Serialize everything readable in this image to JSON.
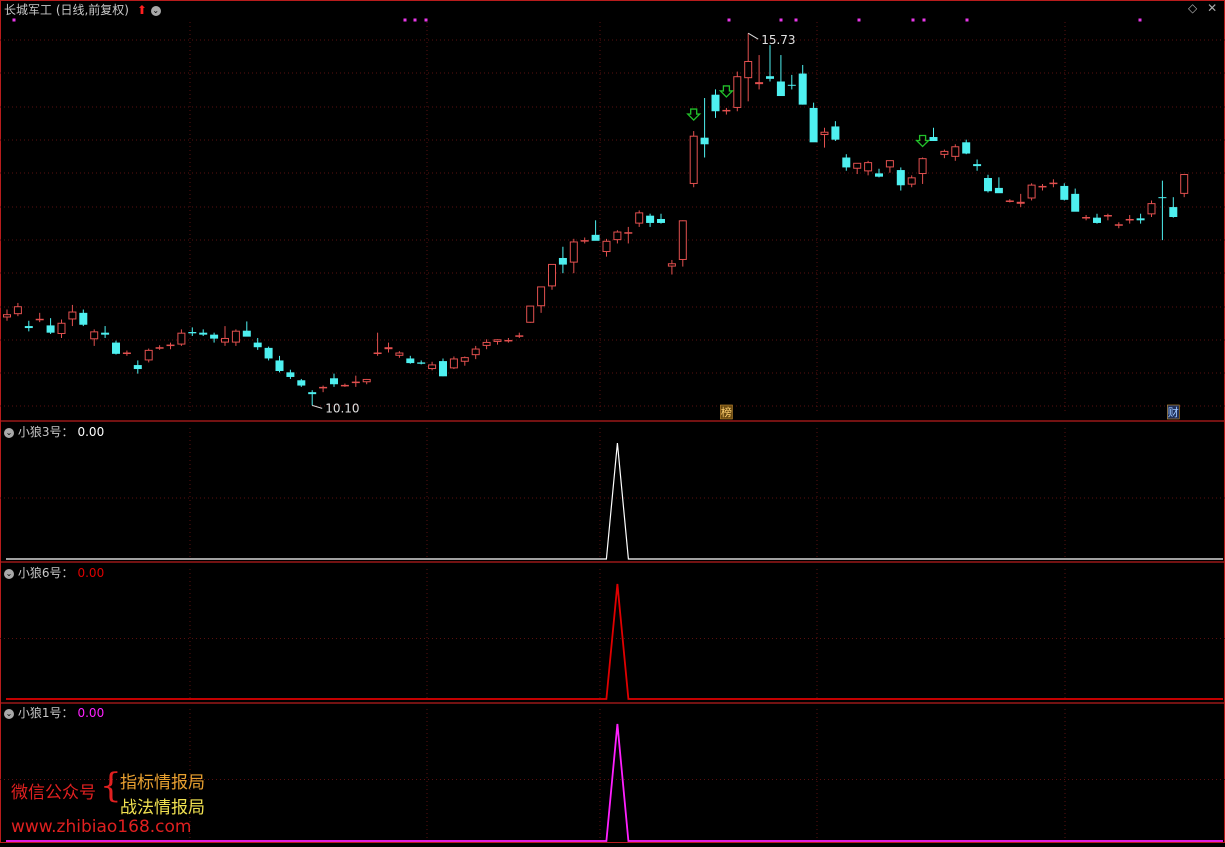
{
  "header": {
    "title": "长城军工 (日线,前复权)",
    "arrow_color": "#ff2020",
    "icons": [
      "red-up-arrow-icon",
      "dropdown-circle-icon",
      "diamond-icon",
      "close-icon"
    ]
  },
  "colors": {
    "background": "#000000",
    "up": "#e2504f",
    "down": "#4ef0f0",
    "grid": "#5a1010",
    "panel_border": "#b81c1c",
    "signal_arrow": "#22c02a",
    "marker_dot": "#e838e8"
  },
  "chart_data": [
    {
      "type": "candlestick",
      "title": "长城军工 (日线,前复权)",
      "annotations": {
        "high_label": "15.73",
        "low_label": "10.10",
        "bottom_markers": [
          "榜",
          "财"
        ]
      },
      "ohlc": [
        [
          11.43,
          11.55,
          11.38,
          11.48
        ],
        [
          11.48,
          11.65,
          11.45,
          11.6
        ],
        [
          11.3,
          11.38,
          11.22,
          11.27
        ],
        [
          11.4,
          11.5,
          11.36,
          11.41
        ],
        [
          11.31,
          11.42,
          11.18,
          11.2
        ],
        [
          11.18,
          11.4,
          11.12,
          11.35
        ],
        [
          11.4,
          11.62,
          11.3,
          11.52
        ],
        [
          11.5,
          11.55,
          11.3,
          11.32
        ],
        [
          11.1,
          11.25,
          11.0,
          11.22
        ],
        [
          11.2,
          11.3,
          11.12,
          11.17
        ],
        [
          11.05,
          11.08,
          10.87,
          10.88
        ],
        [
          10.88,
          10.93,
          10.85,
          10.9
        ],
        [
          10.71,
          10.78,
          10.58,
          10.65
        ],
        [
          10.78,
          10.96,
          10.75,
          10.94
        ],
        [
          10.97,
          11.01,
          10.94,
          10.98
        ],
        [
          11.0,
          11.05,
          10.95,
          11.02
        ],
        [
          11.02,
          11.25,
          11.0,
          11.2
        ],
        [
          11.21,
          11.28,
          11.15,
          11.19
        ],
        [
          11.2,
          11.25,
          11.15,
          11.17
        ],
        [
          11.17,
          11.2,
          11.05,
          11.11
        ],
        [
          11.05,
          11.3,
          11.0,
          11.12
        ],
        [
          11.05,
          11.25,
          11.0,
          11.23
        ],
        [
          11.23,
          11.37,
          11.16,
          11.14
        ],
        [
          11.05,
          11.12,
          10.94,
          10.98
        ],
        [
          10.97,
          10.99,
          10.78,
          10.81
        ],
        [
          10.78,
          10.85,
          10.6,
          10.62
        ],
        [
          10.6,
          10.64,
          10.5,
          10.53
        ],
        [
          10.48,
          10.5,
          10.38,
          10.4
        ],
        [
          10.3,
          10.33,
          10.1,
          10.27
        ],
        [
          10.36,
          10.4,
          10.3,
          10.38
        ],
        [
          10.51,
          10.58,
          10.38,
          10.42
        ],
        [
          10.41,
          10.43,
          10.38,
          10.41
        ],
        [
          10.44,
          10.55,
          10.38,
          10.46
        ],
        [
          10.45,
          10.5,
          10.42,
          10.5
        ],
        [
          10.9,
          11.2,
          10.85,
          10.9
        ],
        [
          10.95,
          11.05,
          10.9,
          10.98
        ],
        [
          10.85,
          10.92,
          10.82,
          10.9
        ],
        [
          10.81,
          10.85,
          10.73,
          10.74
        ],
        [
          10.75,
          10.78,
          10.72,
          10.73
        ],
        [
          10.65,
          10.76,
          10.63,
          10.72
        ],
        [
          10.77,
          10.81,
          10.54,
          10.54
        ],
        [
          10.66,
          10.84,
          10.65,
          10.81
        ],
        [
          10.76,
          10.84,
          10.7,
          10.83
        ],
        [
          10.86,
          11.0,
          10.8,
          10.96
        ],
        [
          11.0,
          11.1,
          10.95,
          11.06
        ],
        [
          11.06,
          11.1,
          11.02,
          11.1
        ],
        [
          11.09,
          11.12,
          11.05,
          11.09
        ],
        [
          11.14,
          11.2,
          11.12,
          11.16
        ],
        [
          11.35,
          11.6,
          11.35,
          11.61
        ],
        [
          11.6,
          11.8,
          11.5,
          11.9
        ],
        [
          11.9,
          12.2,
          11.85,
          12.24
        ],
        [
          12.33,
          12.5,
          12.1,
          12.23
        ],
        [
          12.26,
          12.62,
          12.1,
          12.58
        ],
        [
          12.58,
          12.64,
          12.55,
          12.6
        ],
        [
          12.68,
          12.9,
          12.6,
          12.59
        ],
        [
          12.42,
          12.62,
          12.35,
          12.59
        ],
        [
          12.6,
          12.75,
          12.55,
          12.73
        ],
        [
          12.7,
          12.8,
          12.55,
          12.72
        ],
        [
          12.85,
          13.05,
          12.8,
          13.02
        ],
        [
          12.97,
          13.0,
          12.8,
          12.86
        ],
        [
          12.92,
          13.0,
          12.85,
          12.86
        ],
        [
          12.2,
          12.3,
          12.08,
          12.25
        ],
        [
          12.3,
          12.9,
          12.2,
          12.9
        ],
        [
          13.45,
          14.25,
          13.4,
          14.18
        ],
        [
          14.15,
          14.75,
          13.85,
          14.05
        ],
        [
          14.8,
          14.88,
          14.45,
          14.55
        ],
        [
          14.55,
          14.6,
          14.5,
          14.57
        ],
        [
          14.6,
          15.15,
          14.55,
          15.08
        ],
        [
          15.05,
          15.73,
          14.7,
          15.31
        ],
        [
          14.96,
          15.4,
          14.88,
          14.99
        ],
        [
          15.08,
          15.55,
          15.0,
          15.04
        ],
        [
          15.0,
          15.4,
          14.9,
          14.78
        ],
        [
          14.95,
          15.1,
          14.88,
          14.94
        ],
        [
          15.12,
          15.25,
          14.65,
          14.65
        ],
        [
          14.6,
          14.68,
          14.1,
          14.08
        ],
        [
          14.19,
          14.3,
          14.0,
          14.24
        ],
        [
          14.32,
          14.4,
          14.1,
          14.12
        ],
        [
          13.85,
          13.9,
          13.65,
          13.7
        ],
        [
          13.68,
          13.72,
          13.6,
          13.77
        ],
        [
          13.64,
          13.8,
          13.58,
          13.78
        ],
        [
          13.61,
          13.68,
          13.55,
          13.56
        ],
        [
          13.7,
          13.8,
          13.62,
          13.81
        ],
        [
          13.66,
          13.7,
          13.35,
          13.43
        ],
        [
          13.44,
          13.58,
          13.4,
          13.55
        ],
        [
          13.6,
          13.85,
          13.45,
          13.84
        ],
        [
          14.16,
          14.3,
          14.1,
          14.1
        ],
        [
          13.89,
          13.97,
          13.84,
          13.95
        ],
        [
          13.86,
          14.05,
          13.8,
          14.02
        ],
        [
          14.08,
          14.12,
          13.9,
          13.91
        ],
        [
          13.75,
          13.82,
          13.65,
          13.72
        ],
        [
          13.54,
          13.59,
          13.32,
          13.34
        ],
        [
          13.39,
          13.55,
          13.34,
          13.31
        ],
        [
          13.2,
          13.22,
          13.17,
          13.2
        ],
        [
          13.15,
          13.3,
          13.1,
          13.18
        ],
        [
          13.23,
          13.46,
          13.2,
          13.44
        ],
        [
          13.4,
          13.45,
          13.35,
          13.42
        ],
        [
          13.46,
          13.52,
          13.4,
          13.47
        ],
        [
          13.42,
          13.46,
          13.2,
          13.21
        ],
        [
          13.3,
          13.38,
          13.06,
          13.03
        ],
        [
          12.93,
          12.98,
          12.9,
          12.95
        ],
        [
          12.94,
          13.0,
          12.85,
          12.86
        ],
        [
          12.97,
          13.0,
          12.9,
          12.98
        ],
        [
          12.82,
          12.87,
          12.78,
          12.84
        ],
        [
          12.9,
          12.98,
          12.85,
          12.92
        ],
        [
          12.93,
          13.0,
          12.85,
          12.9
        ],
        [
          12.99,
          13.2,
          12.95,
          13.16
        ],
        [
          13.25,
          13.5,
          12.6,
          13.24
        ],
        [
          13.1,
          13.25,
          12.94,
          12.95
        ],
        [
          13.3,
          13.6,
          13.25,
          13.6
        ]
      ],
      "ylim": [
        10.0,
        15.9
      ]
    },
    {
      "type": "line",
      "name": "小狼3号",
      "value_label": "0.00",
      "spike_index": 56,
      "values_note": "",
      "ylim": [
        0,
        1
      ]
    },
    {
      "type": "line",
      "name": "小狼6号",
      "value_label": "0.00",
      "spike_index": 56,
      "ylim": [
        0,
        1
      ]
    },
    {
      "type": "line",
      "name": "小狼1号",
      "value_label": "0.00",
      "spike_index": 56,
      "ylim": [
        0,
        1
      ]
    }
  ],
  "indicators": [
    {
      "name": "小狼3号",
      "value": "0.00",
      "color": "#ffffff",
      "value_color": "#ffffff"
    },
    {
      "name": "小狼6号",
      "value": "0.00",
      "color": "#e00000",
      "value_color": "#e00000"
    },
    {
      "name": "小狼1号",
      "value": "0.00",
      "color": "#ff20ff",
      "value_color": "#ff20ff"
    }
  ],
  "signals": {
    "down_arrow_indices": [
      63,
      66,
      84
    ]
  },
  "watermark": {
    "left": "微信公众号",
    "line1": "指标情报局",
    "line2": "战法情报局",
    "url": "www.zhibiao168.com"
  }
}
